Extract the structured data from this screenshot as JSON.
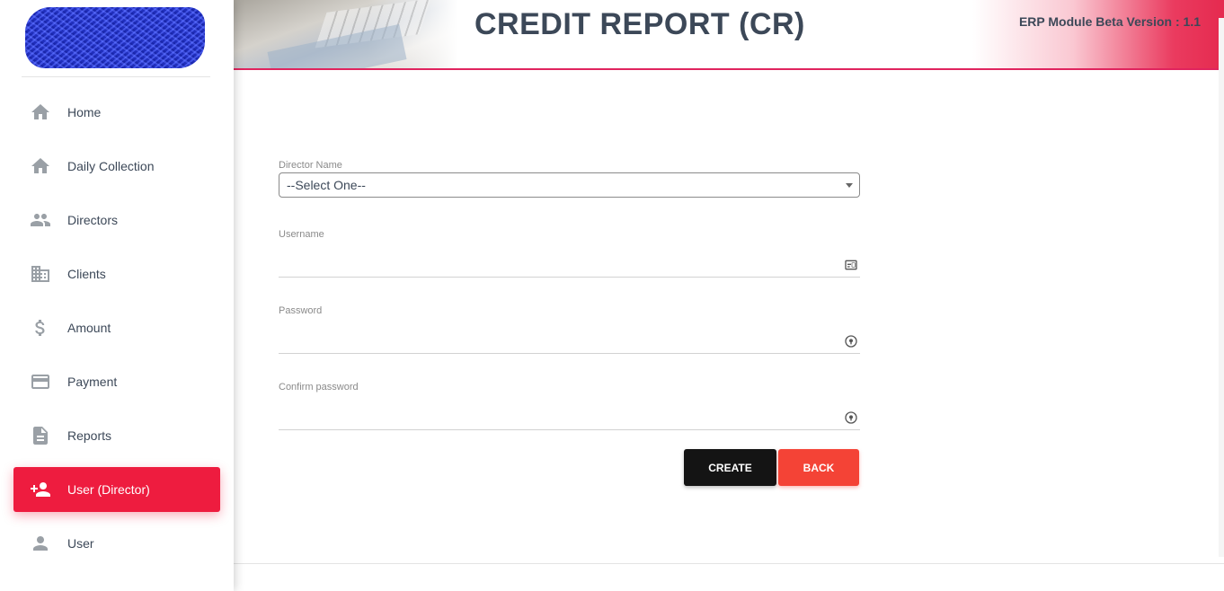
{
  "header": {
    "title": "CREDIT REPORT (CR)",
    "version": "ERP Module Beta Version : 1.1"
  },
  "sidebar": {
    "items": [
      {
        "label": "Home",
        "icon": "home-icon",
        "active": false
      },
      {
        "label": "Daily Collection",
        "icon": "home-icon",
        "active": false
      },
      {
        "label": "Directors",
        "icon": "people-icon",
        "active": false
      },
      {
        "label": "Clients",
        "icon": "building-icon",
        "active": false
      },
      {
        "label": "Amount",
        "icon": "dollar-icon",
        "active": false
      },
      {
        "label": "Payment",
        "icon": "credit-card-icon",
        "active": false
      },
      {
        "label": "Reports",
        "icon": "document-icon",
        "active": false
      },
      {
        "label": "User (Director)",
        "icon": "person-add-icon",
        "active": true
      },
      {
        "label": "User",
        "icon": "person-icon",
        "active": false
      }
    ]
  },
  "form": {
    "director_name": {
      "label": "Director Name",
      "value": "--Select One--"
    },
    "username": {
      "label": "Username",
      "value": "",
      "icon": "id-card-icon"
    },
    "password": {
      "label": "Password",
      "value": "",
      "icon": "lock-dial-icon"
    },
    "confirm_password": {
      "label": "Confirm password",
      "value": "",
      "icon": "lock-dial-icon"
    },
    "create_label": "CREATE",
    "back_label": "BACK"
  },
  "colors": {
    "accent": "#ee1c3f",
    "create_button": "#141414",
    "back_button": "#f44336",
    "text": "#3c4858"
  }
}
